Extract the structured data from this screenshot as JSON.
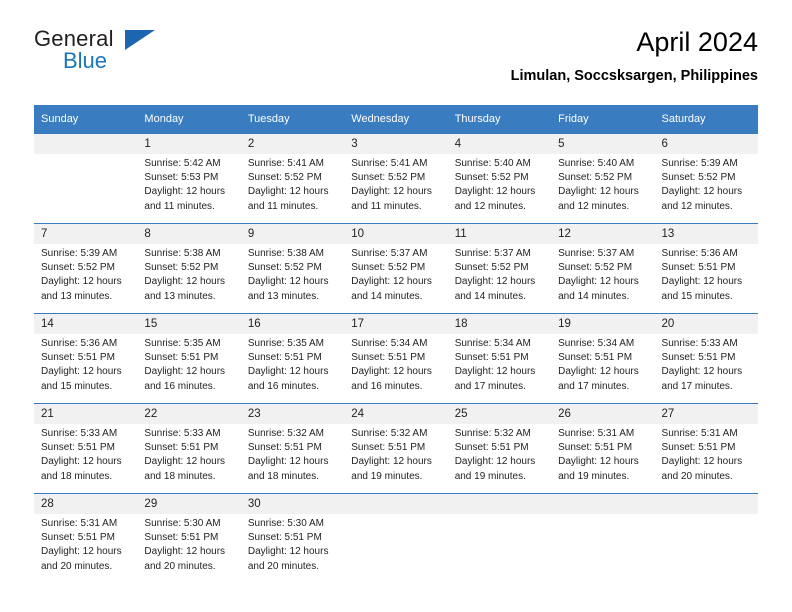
{
  "brand": {
    "name_top": "General",
    "name_bottom": "Blue",
    "triangle_color": "#1b66ae",
    "blue_color": "#1b75bb"
  },
  "header": {
    "title": "April 2024",
    "subtitle": "Limulan, Soccsksargen, Philippines"
  },
  "theme": {
    "header_bg": "#3a7cc0",
    "header_text": "#ffffff",
    "row_shade": "#f1f1f1",
    "body_text": "#231f20"
  },
  "weekdays": [
    "Sunday",
    "Monday",
    "Tuesday",
    "Wednesday",
    "Thursday",
    "Friday",
    "Saturday"
  ],
  "calendar_data": {
    "month": "April",
    "year": 2024,
    "location": "Limulan, Soccsksargen, Philippines",
    "first_weekday_index": 1,
    "days_in_month": 30,
    "fields": [
      "Sunrise",
      "Sunset",
      "Daylight"
    ],
    "weeks": [
      [
        {
          "day": "",
          "sunrise": "",
          "sunset": "",
          "daylight_line1": "",
          "daylight_line2": ""
        },
        {
          "day": "1",
          "sunrise": "Sunrise: 5:42 AM",
          "sunset": "Sunset: 5:53 PM",
          "daylight_line1": "Daylight: 12 hours",
          "daylight_line2": "and 11 minutes."
        },
        {
          "day": "2",
          "sunrise": "Sunrise: 5:41 AM",
          "sunset": "Sunset: 5:52 PM",
          "daylight_line1": "Daylight: 12 hours",
          "daylight_line2": "and 11 minutes."
        },
        {
          "day": "3",
          "sunrise": "Sunrise: 5:41 AM",
          "sunset": "Sunset: 5:52 PM",
          "daylight_line1": "Daylight: 12 hours",
          "daylight_line2": "and 11 minutes."
        },
        {
          "day": "4",
          "sunrise": "Sunrise: 5:40 AM",
          "sunset": "Sunset: 5:52 PM",
          "daylight_line1": "Daylight: 12 hours",
          "daylight_line2": "and 12 minutes."
        },
        {
          "day": "5",
          "sunrise": "Sunrise: 5:40 AM",
          "sunset": "Sunset: 5:52 PM",
          "daylight_line1": "Daylight: 12 hours",
          "daylight_line2": "and 12 minutes."
        },
        {
          "day": "6",
          "sunrise": "Sunrise: 5:39 AM",
          "sunset": "Sunset: 5:52 PM",
          "daylight_line1": "Daylight: 12 hours",
          "daylight_line2": "and 12 minutes."
        }
      ],
      [
        {
          "day": "7",
          "sunrise": "Sunrise: 5:39 AM",
          "sunset": "Sunset: 5:52 PM",
          "daylight_line1": "Daylight: 12 hours",
          "daylight_line2": "and 13 minutes."
        },
        {
          "day": "8",
          "sunrise": "Sunrise: 5:38 AM",
          "sunset": "Sunset: 5:52 PM",
          "daylight_line1": "Daylight: 12 hours",
          "daylight_line2": "and 13 minutes."
        },
        {
          "day": "9",
          "sunrise": "Sunrise: 5:38 AM",
          "sunset": "Sunset: 5:52 PM",
          "daylight_line1": "Daylight: 12 hours",
          "daylight_line2": "and 13 minutes."
        },
        {
          "day": "10",
          "sunrise": "Sunrise: 5:37 AM",
          "sunset": "Sunset: 5:52 PM",
          "daylight_line1": "Daylight: 12 hours",
          "daylight_line2": "and 14 minutes."
        },
        {
          "day": "11",
          "sunrise": "Sunrise: 5:37 AM",
          "sunset": "Sunset: 5:52 PM",
          "daylight_line1": "Daylight: 12 hours",
          "daylight_line2": "and 14 minutes."
        },
        {
          "day": "12",
          "sunrise": "Sunrise: 5:37 AM",
          "sunset": "Sunset: 5:52 PM",
          "daylight_line1": "Daylight: 12 hours",
          "daylight_line2": "and 14 minutes."
        },
        {
          "day": "13",
          "sunrise": "Sunrise: 5:36 AM",
          "sunset": "Sunset: 5:51 PM",
          "daylight_line1": "Daylight: 12 hours",
          "daylight_line2": "and 15 minutes."
        }
      ],
      [
        {
          "day": "14",
          "sunrise": "Sunrise: 5:36 AM",
          "sunset": "Sunset: 5:51 PM",
          "daylight_line1": "Daylight: 12 hours",
          "daylight_line2": "and 15 minutes."
        },
        {
          "day": "15",
          "sunrise": "Sunrise: 5:35 AM",
          "sunset": "Sunset: 5:51 PM",
          "daylight_line1": "Daylight: 12 hours",
          "daylight_line2": "and 16 minutes."
        },
        {
          "day": "16",
          "sunrise": "Sunrise: 5:35 AM",
          "sunset": "Sunset: 5:51 PM",
          "daylight_line1": "Daylight: 12 hours",
          "daylight_line2": "and 16 minutes."
        },
        {
          "day": "17",
          "sunrise": "Sunrise: 5:34 AM",
          "sunset": "Sunset: 5:51 PM",
          "daylight_line1": "Daylight: 12 hours",
          "daylight_line2": "and 16 minutes."
        },
        {
          "day": "18",
          "sunrise": "Sunrise: 5:34 AM",
          "sunset": "Sunset: 5:51 PM",
          "daylight_line1": "Daylight: 12 hours",
          "daylight_line2": "and 17 minutes."
        },
        {
          "day": "19",
          "sunrise": "Sunrise: 5:34 AM",
          "sunset": "Sunset: 5:51 PM",
          "daylight_line1": "Daylight: 12 hours",
          "daylight_line2": "and 17 minutes."
        },
        {
          "day": "20",
          "sunrise": "Sunrise: 5:33 AM",
          "sunset": "Sunset: 5:51 PM",
          "daylight_line1": "Daylight: 12 hours",
          "daylight_line2": "and 17 minutes."
        }
      ],
      [
        {
          "day": "21",
          "sunrise": "Sunrise: 5:33 AM",
          "sunset": "Sunset: 5:51 PM",
          "daylight_line1": "Daylight: 12 hours",
          "daylight_line2": "and 18 minutes."
        },
        {
          "day": "22",
          "sunrise": "Sunrise: 5:33 AM",
          "sunset": "Sunset: 5:51 PM",
          "daylight_line1": "Daylight: 12 hours",
          "daylight_line2": "and 18 minutes."
        },
        {
          "day": "23",
          "sunrise": "Sunrise: 5:32 AM",
          "sunset": "Sunset: 5:51 PM",
          "daylight_line1": "Daylight: 12 hours",
          "daylight_line2": "and 18 minutes."
        },
        {
          "day": "24",
          "sunrise": "Sunrise: 5:32 AM",
          "sunset": "Sunset: 5:51 PM",
          "daylight_line1": "Daylight: 12 hours",
          "daylight_line2": "and 19 minutes."
        },
        {
          "day": "25",
          "sunrise": "Sunrise: 5:32 AM",
          "sunset": "Sunset: 5:51 PM",
          "daylight_line1": "Daylight: 12 hours",
          "daylight_line2": "and 19 minutes."
        },
        {
          "day": "26",
          "sunrise": "Sunrise: 5:31 AM",
          "sunset": "Sunset: 5:51 PM",
          "daylight_line1": "Daylight: 12 hours",
          "daylight_line2": "and 19 minutes."
        },
        {
          "day": "27",
          "sunrise": "Sunrise: 5:31 AM",
          "sunset": "Sunset: 5:51 PM",
          "daylight_line1": "Daylight: 12 hours",
          "daylight_line2": "and 20 minutes."
        }
      ],
      [
        {
          "day": "28",
          "sunrise": "Sunrise: 5:31 AM",
          "sunset": "Sunset: 5:51 PM",
          "daylight_line1": "Daylight: 12 hours",
          "daylight_line2": "and 20 minutes."
        },
        {
          "day": "29",
          "sunrise": "Sunrise: 5:30 AM",
          "sunset": "Sunset: 5:51 PM",
          "daylight_line1": "Daylight: 12 hours",
          "daylight_line2": "and 20 minutes."
        },
        {
          "day": "30",
          "sunrise": "Sunrise: 5:30 AM",
          "sunset": "Sunset: 5:51 PM",
          "daylight_line1": "Daylight: 12 hours",
          "daylight_line2": "and 20 minutes."
        },
        {
          "day": "",
          "sunrise": "",
          "sunset": "",
          "daylight_line1": "",
          "daylight_line2": ""
        },
        {
          "day": "",
          "sunrise": "",
          "sunset": "",
          "daylight_line1": "",
          "daylight_line2": ""
        },
        {
          "day": "",
          "sunrise": "",
          "sunset": "",
          "daylight_line1": "",
          "daylight_line2": ""
        },
        {
          "day": "",
          "sunrise": "",
          "sunset": "",
          "daylight_line1": "",
          "daylight_line2": ""
        }
      ]
    ]
  }
}
